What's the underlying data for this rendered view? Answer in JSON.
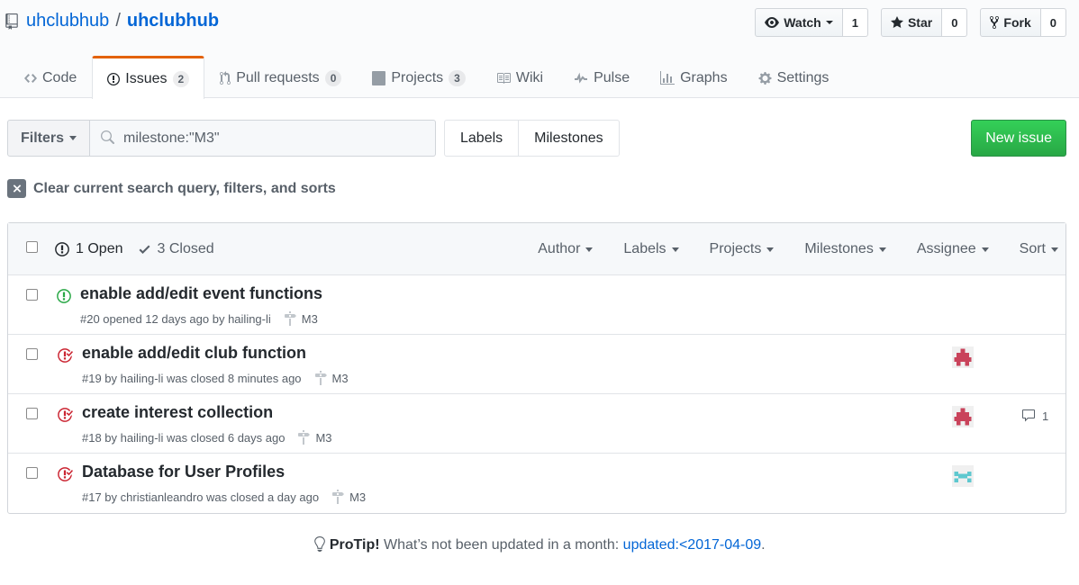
{
  "repo": {
    "owner": "uhclubhub",
    "separator": "/",
    "name": "uhclubhub"
  },
  "actions": {
    "watch": {
      "label": "Watch",
      "count": "1"
    },
    "star": {
      "label": "Star",
      "count": "0"
    },
    "fork": {
      "label": "Fork",
      "count": "0"
    }
  },
  "nav": {
    "code": "Code",
    "issues": {
      "label": "Issues",
      "count": "2"
    },
    "pulls": {
      "label": "Pull requests",
      "count": "0"
    },
    "projects": {
      "label": "Projects",
      "count": "3"
    },
    "wiki": "Wiki",
    "pulse": "Pulse",
    "graphs": "Graphs",
    "settings": "Settings"
  },
  "subnav": {
    "filters_label": "Filters",
    "search_value": "milestone:\"M3\"",
    "labels": "Labels",
    "milestones": "Milestones",
    "new_issue": "New issue"
  },
  "clear_query": "Clear current search query, filters, and sorts",
  "box_header": {
    "open": "1 Open",
    "closed": "3 Closed",
    "filters": [
      "Author",
      "Labels",
      "Projects",
      "Milestones",
      "Assignee",
      "Sort"
    ]
  },
  "issues": [
    {
      "title": "enable add/edit event functions",
      "meta": "#20 opened 12 days ago by hailing-li",
      "milestone": "M3",
      "state": "open",
      "avatar": "",
      "comments": ""
    },
    {
      "title": "enable add/edit club function",
      "meta": "#19 by hailing-li was closed 8 minutes ago",
      "milestone": "M3",
      "state": "closed",
      "avatar": "red",
      "comments": ""
    },
    {
      "title": "create interest collection",
      "meta": "#18 by hailing-li was closed 6 days ago",
      "milestone": "M3",
      "state": "closed",
      "avatar": "red",
      "comments": "1"
    },
    {
      "title": "Database for User Profiles",
      "meta": "#17 by christianleandro was closed a day ago",
      "milestone": "M3",
      "state": "closed",
      "avatar": "teal",
      "comments": ""
    }
  ],
  "protip": {
    "label": "ProTip!",
    "text": "What’s not been updated in a month:",
    "link": "updated:<2017-04-09",
    "end": "."
  },
  "colors": {
    "open": "#28a745",
    "closed": "#cb2431",
    "link": "#0366d6",
    "avatar_red": "#c9435b",
    "avatar_teal": "#5ec8cf"
  }
}
